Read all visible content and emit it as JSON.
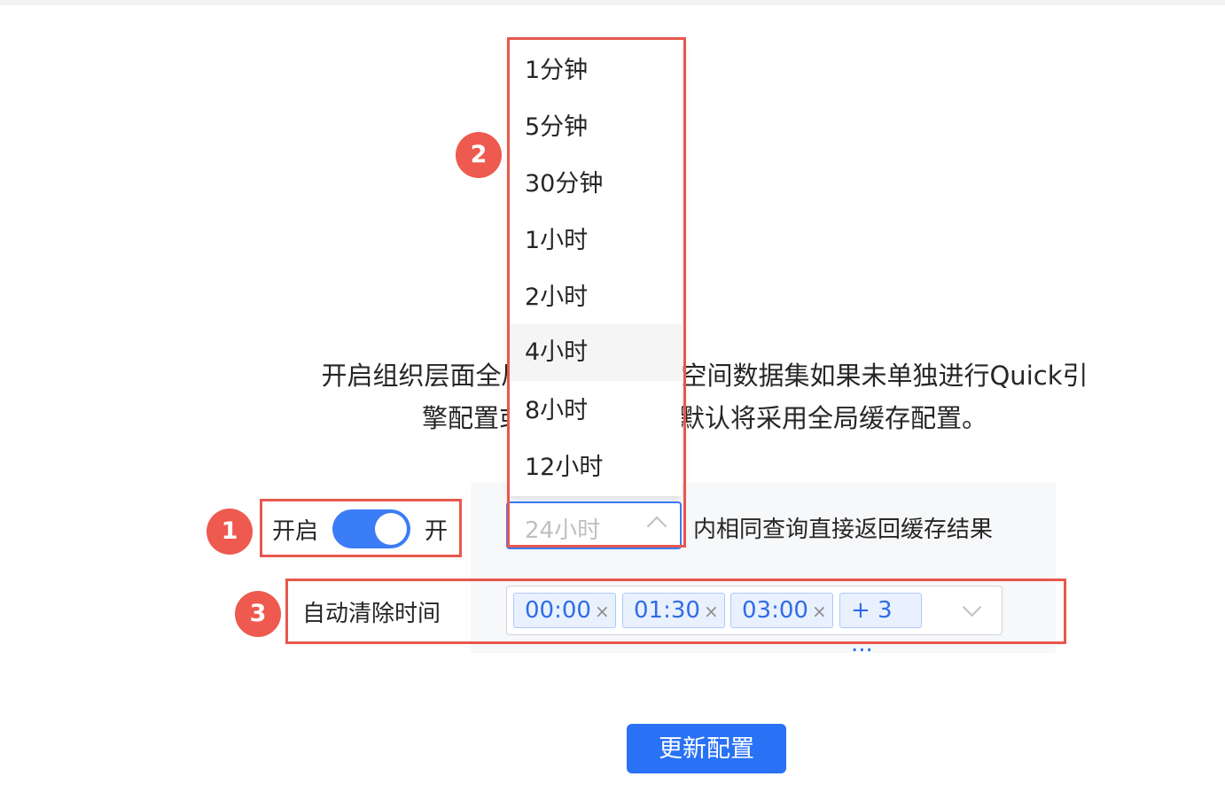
{
  "description": {
    "line1": "开启组织层面全局缓存后，工作空间数据集如果未单独进行Quick引",
    "line2": "擎配置或关闭缓存，将默认将采用全局缓存配置。"
  },
  "cache_switch": {
    "label": "开启",
    "state_text": "开",
    "on": true
  },
  "cache_duration": {
    "selected": "24小时",
    "suffix": "内相同查询直接返回缓存结果",
    "options": [
      "1分钟",
      "5分钟",
      "30分钟",
      "1小时",
      "2小时",
      "4小时",
      "8小时",
      "12小时"
    ],
    "hovered": "4小时"
  },
  "auto_clear": {
    "label": "自动清除时间",
    "tags": [
      "00:00",
      "01:30",
      "03:00"
    ],
    "more": "+ 3 ...",
    "remove_glyph": "×"
  },
  "update_button": "更新配置",
  "badges": [
    "1",
    "2",
    "3"
  ],
  "colors": {
    "accent": "#2a72f5",
    "annotation": "#e8574e"
  }
}
